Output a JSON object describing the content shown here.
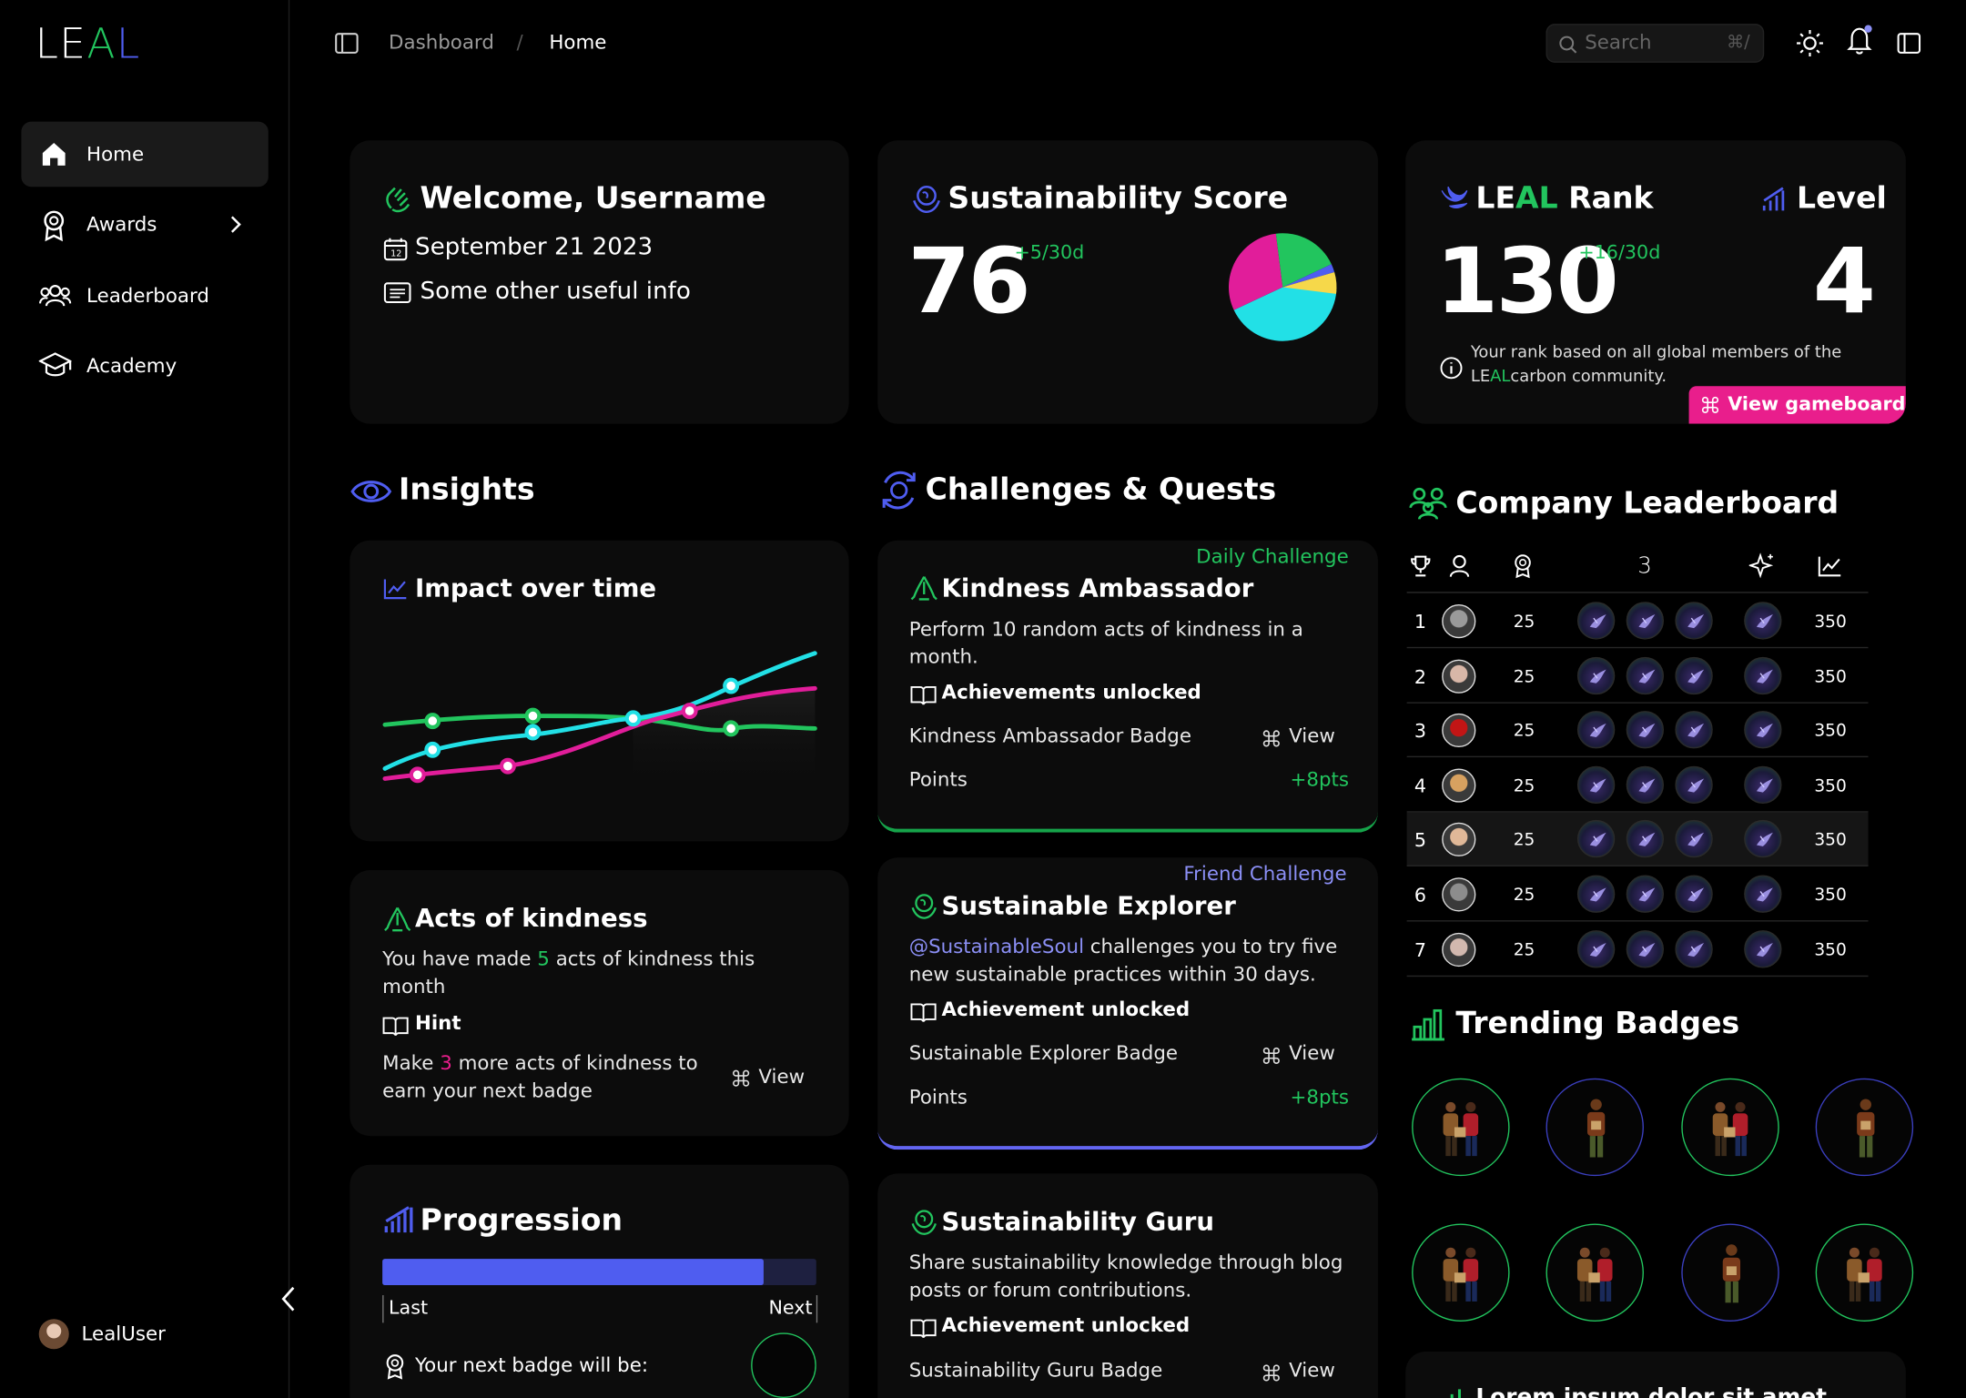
{
  "brand": {
    "logo_a": "LE",
    "logo_b": "A",
    "logo_c": "L",
    "colors": {
      "green": "#22c55e",
      "blue": "#4f5df0",
      "magenta": "#e11d9a",
      "cyan": "#22e0e6",
      "yellow": "#f6d84a",
      "pink": "#e91e8c"
    }
  },
  "sidebar": {
    "items": [
      {
        "label": "Home"
      },
      {
        "label": "Awards"
      },
      {
        "label": "Leaderboard"
      },
      {
        "label": "Academy"
      }
    ],
    "user": "LealUser"
  },
  "header": {
    "breadcrumb_root": "Dashboard",
    "breadcrumb_sep": "/",
    "breadcrumb_current": "Home",
    "search_placeholder": "Search",
    "search_shortcut": "⌘/"
  },
  "welcome": {
    "title": "Welcome, Username",
    "date": "September 21 2023",
    "info": "Some other useful info"
  },
  "score": {
    "title": "Sustainability Score",
    "value": "76",
    "delta": "+5/30d",
    "pie": [
      0.3,
      0.42,
      0.2,
      0.08
    ]
  },
  "rank": {
    "title_a": "LE",
    "title_b": "AL",
    "title_c": " Rank",
    "level_title": "Level",
    "value": "130",
    "delta": "+16/30d",
    "level": "4",
    "note_1": "Your rank based on all global members of the",
    "note_2a": "LE",
    "note_2b": "AL",
    "note_2c": "carbon community.",
    "gameboard": "View gameboard"
  },
  "insights": {
    "title": "Insights",
    "impact_title": "Impact over time",
    "kind_title": "Acts of kindness",
    "kind_pre": "You have made ",
    "kind_num": "5",
    "kind_post": " acts of kindness this",
    "kind_line2": "month",
    "hint_label": "Hint",
    "hint_pre": "Make ",
    "hint_num": "3",
    "hint_post": " more acts of kindness to",
    "hint_line2": "earn your next badge",
    "view": "View",
    "prog_title": "Progression",
    "progress": 0.88,
    "last": "Last",
    "next": "Next",
    "next_badge": "Your next badge will be:"
  },
  "challenges": {
    "title": "Challenges & Quests",
    "items": [
      {
        "tag": "Daily Challenge",
        "title": "Kindness Ambassador",
        "desc1": "Perform 10 random acts of kindness in a",
        "desc2": "month.",
        "ach": "Achievements unlocked",
        "badge": "Kindness Ambassador Badge",
        "view": "View",
        "points_label": "Points",
        "points": "+8pts"
      },
      {
        "tag": "Friend Challenge",
        "title": "Sustainable Explorer",
        "mention": "@SustainableSoul",
        "desc1": " challenges you to try five",
        "desc2": "new sustainable practices within 30 days.",
        "ach": "Achievement unlocked",
        "badge": "Sustainable Explorer Badge",
        "view": "View",
        "points_label": "Points",
        "points": "+8pts"
      },
      {
        "title": "Sustainability Guru",
        "desc1": "Share sustainability knowledge through blog",
        "desc2": "posts or forum contributions.",
        "ach": "Achievement unlocked",
        "badge": "Sustainability Guru Badge",
        "view": "View"
      }
    ]
  },
  "leaderboard": {
    "title": "Company Leaderboard",
    "col_count": "3",
    "rows": [
      {
        "rank": "1",
        "val": "25",
        "pts": "350"
      },
      {
        "rank": "2",
        "val": "25",
        "pts": "350"
      },
      {
        "rank": "3",
        "val": "25",
        "pts": "350"
      },
      {
        "rank": "4",
        "val": "25",
        "pts": "350"
      },
      {
        "rank": "5",
        "val": "25",
        "pts": "350"
      },
      {
        "rank": "6",
        "val": "25",
        "pts": "350"
      },
      {
        "rank": "7",
        "val": "25",
        "pts": "350"
      }
    ]
  },
  "trending": {
    "title": "Trending Badges",
    "footer": "Lorem ipsum dolor sit amet"
  },
  "chart_data": {
    "type": "line",
    "series": [
      {
        "color": "#22c55e",
        "points": [
          [
            0,
            0.62
          ],
          [
            1,
            0.66
          ],
          [
            2,
            0.64
          ],
          [
            3,
            0.52
          ],
          [
            4,
            0.55
          ]
        ]
      },
      {
        "color": "#22e0e6",
        "points": [
          [
            0,
            0.35
          ],
          [
            1,
            0.48
          ],
          [
            2,
            0.62
          ],
          [
            3,
            0.88
          ],
          [
            4,
            1.0
          ]
        ]
      },
      {
        "color": "#e11d9a",
        "points": [
          [
            0,
            0.1
          ],
          [
            1,
            0.2
          ],
          [
            2,
            0.5
          ],
          [
            3,
            0.7
          ],
          [
            4,
            0.82
          ]
        ]
      }
    ]
  }
}
